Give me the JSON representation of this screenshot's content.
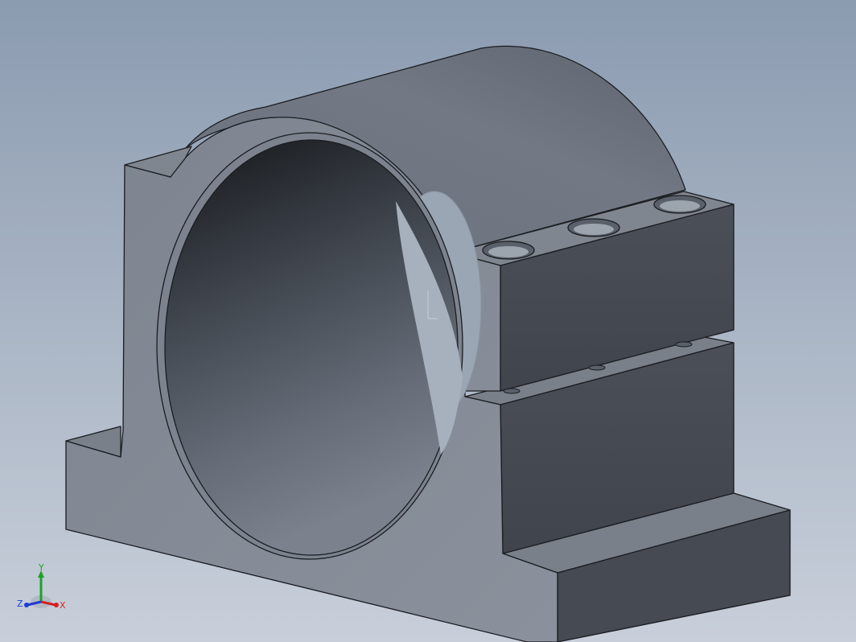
{
  "viewport": {
    "background_top": "#8d9db1",
    "background_bottom": "#c6cdd8"
  },
  "part": {
    "body_color": "#6f7681",
    "dark_face_color": "#484c55",
    "top_face_color": "#7a8089",
    "edge_color": "#1a1c20",
    "bore_hole_count": 3
  },
  "triad": {
    "x_label": "X",
    "y_label": "Y",
    "z_label": "Z",
    "x_color": "#d42020",
    "y_color": "#1fa02a",
    "z_color": "#1f3bd0"
  }
}
